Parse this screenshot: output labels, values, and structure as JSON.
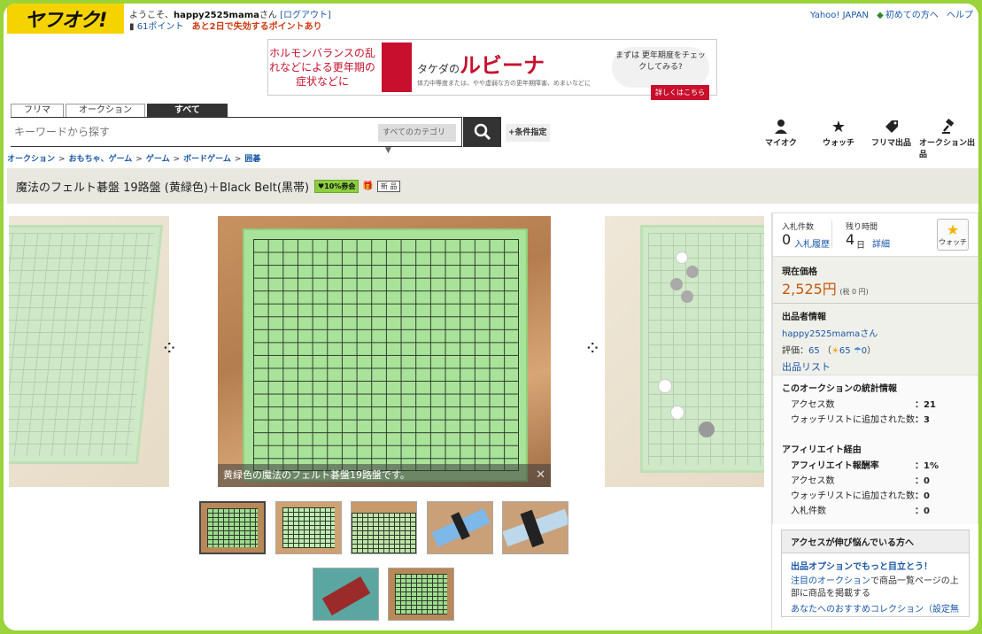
{
  "header": {
    "logo_text": "ヤフオク!",
    "welcome_prefix": "ようこそ、",
    "username": "happy2525mama",
    "welcome_suffix": "さん",
    "logout": "[ログアウト]",
    "points": "61ポイント",
    "points_warning": "あと2日で失効するポイントあり",
    "yahoo_japan": "Yahoo! JAPAN",
    "first_time": "初めての方へ",
    "help": "ヘルプ"
  },
  "banner": {
    "left_text": "ホルモンバランスの乱れなどによる更年期の症状などに",
    "brand_prefix": "タケダの",
    "brand": "ルビーナ",
    "sub": "体力中等度または、やや虚弱な方の更年期障害、めまいなどに",
    "bubble": "まずは 更年期度をチェックしてみる?",
    "more": "詳しくはこちら"
  },
  "tabs": [
    "フリマ",
    "オークション",
    "すべて"
  ],
  "search": {
    "placeholder": "キーワードから探す",
    "category": "すべてのカテゴリ",
    "conditions": "+条件指定"
  },
  "icon_nav": [
    {
      "label": "マイオク",
      "icon": "person-icon"
    },
    {
      "label": "ウォッチ",
      "icon": "star-icon"
    },
    {
      "label": "フリマ出品",
      "icon": "tag-icon"
    },
    {
      "label": "オークション出品",
      "icon": "gavel-icon"
    }
  ],
  "breadcrumb": [
    "オークション",
    "おもちゃ、ゲーム",
    "ゲーム",
    "ボードゲーム",
    "囲碁"
  ],
  "title": {
    "text": "魔法のフェルト碁盤 19路盤 (黄緑色)＋Black Belt(黒帯)",
    "coupon": "10%券会",
    "new_badge": "新 品"
  },
  "gallery": {
    "caption": "黄緑色の魔法のフェルト碁盤19路盤です。",
    "close": "✕"
  },
  "panel": {
    "bids_label": "入札件数",
    "bids_value": "0",
    "bid_history": "入札履歴",
    "remaining_label": "残り時間",
    "remaining_value": "4",
    "remaining_unit": "日",
    "details": "詳細",
    "watch": "ウォッチ",
    "price_label": "現在価格",
    "price": "2,525円",
    "tax": "(税 0 円)",
    "seller_label": "出品者情報",
    "seller_name": "happy2525mamaさん",
    "rating_label": "評価：",
    "rating_total": "65",
    "rating_good": "65",
    "rating_bad": "0",
    "item_list": "出品リスト",
    "stats_label": "このオークションの統計情報",
    "stats": [
      {
        "k": "アクセス数",
        "v": "：21"
      },
      {
        "k": "ウォッチリストに追加された数",
        "v": "：3"
      }
    ],
    "aff_label": "アフィリエイト経由",
    "aff": [
      {
        "k": "アフィリエイト報酬率",
        "v": "：1%"
      },
      {
        "k": "アクセス数",
        "v": "：0"
      },
      {
        "k": "ウォッチリストに追加された数",
        "v": "：0"
      },
      {
        "k": "入札件数",
        "v": "：0"
      }
    ],
    "help_title": "アクセスが伸び悩んでいる方へ",
    "help_link": "出品オプションでもっと目立とう！",
    "help_p1_link": "注目のオークション",
    "help_p1_rest": "で商品一覧ページの上部に商品を掲載する",
    "help_p2": "あなたへのおすすめコレクション（設定無"
  },
  "colors": {
    "frame": "#9ad33a",
    "logo": "#f5d300",
    "link": "#1a57a8",
    "price": "#c8580a",
    "board": "#a9e39a"
  }
}
